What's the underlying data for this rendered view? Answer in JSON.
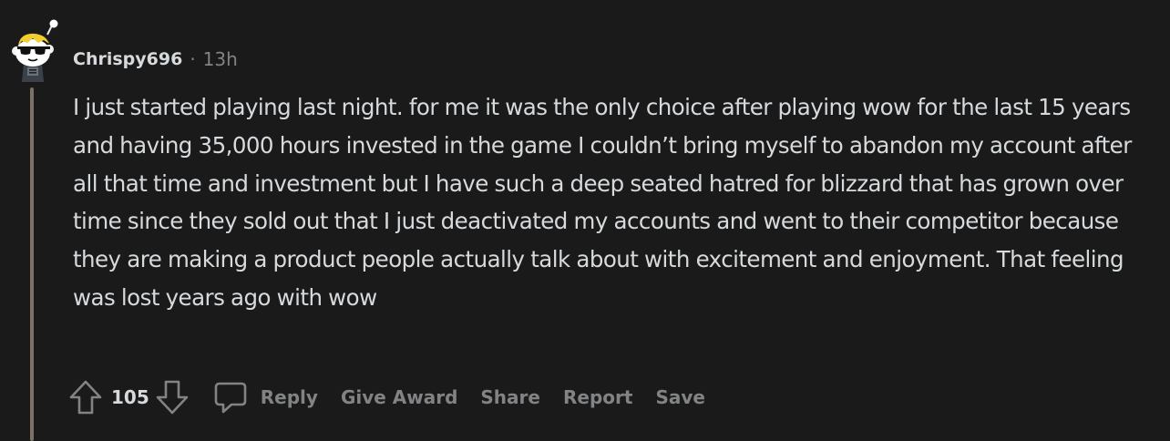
{
  "comment": {
    "author": "Chrispy696",
    "separator": "·",
    "age": "13h",
    "avatar_icon": "snoo-sunglasses-avatar-icon",
    "body": "I just started playing last night. for me it was the only choice after playing wow for the last 15 years and having 35,000 hours invested in the game I couldn’t bring myself to abandon my account after all that time and investment but I have such a deep seated hatred for blizzard that has grown over time since they sold out that I just deactivated my accounts and went to their competitor because they are making a product people actually talk about with excitement and enjoyment. That feeling was lost years ago with wow"
  },
  "actions": {
    "upvote_icon": "arrow-up-icon",
    "vote_count": "105",
    "downvote_icon": "arrow-down-icon",
    "reply_icon": "speech-bubble-icon",
    "reply_label": "Reply",
    "award_label": "Give Award",
    "share_label": "Share",
    "report_label": "Report",
    "save_label": "Save"
  },
  "colors": {
    "background": "#1a1a1b",
    "text_primary": "#d7dadc",
    "text_muted": "#818384",
    "thread_line": "#7b7164"
  }
}
